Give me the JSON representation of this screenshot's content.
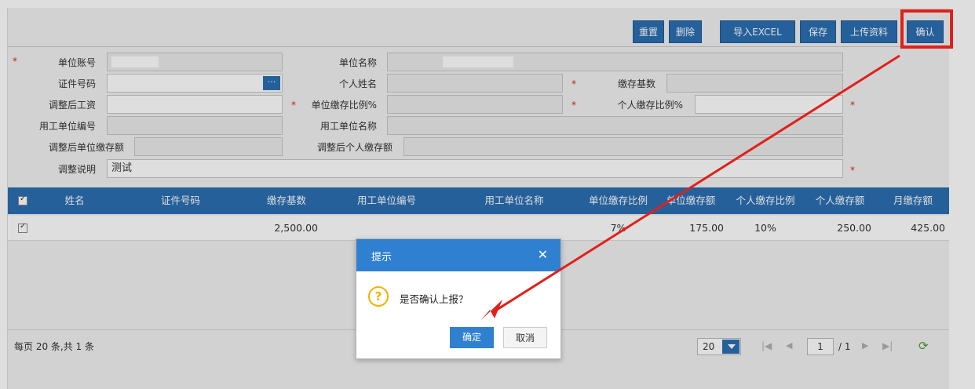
{
  "toolbar": {
    "buttons": [
      {
        "label": "重置"
      },
      {
        "label": "删除"
      },
      {
        "label": "导入EXCEL"
      },
      {
        "label": "保存"
      },
      {
        "label": "上传资料"
      },
      {
        "label": "确认"
      }
    ]
  },
  "form": {
    "required_mark": "*",
    "ellipsis": "···",
    "labels": {
      "unit_account": "单位账号",
      "unit_name": "单位名称",
      "id_number": "证件号码",
      "personal_name": "个人姓名",
      "deposit_base": "缴存基数",
      "adjusted_salary": "调整后工资",
      "unit_ratio": "单位缴存比例%",
      "personal_ratio": "个人缴存比例%",
      "employer_code": "用工单位编号",
      "employer_name": "用工单位名称",
      "adjusted_unit_amount": "调整后单位缴存额",
      "adjusted_personal_amount": "调整后个人缴存额",
      "adjust_note": "调整说明"
    },
    "values": {
      "adjust_note": "测试"
    }
  },
  "grid": {
    "columns": [
      "姓名",
      "证件号码",
      "缴存基数",
      "用工单位编号",
      "用工单位名称",
      "单位缴存比例",
      "单位缴存额",
      "个人缴存比例",
      "个人缴存额",
      "月缴存额"
    ],
    "rows": [
      {
        "base": "2,500.00",
        "unit_ratio": "7%",
        "unit_amount": "175.00",
        "personal_ratio": "10%",
        "personal_amount": "250.00",
        "monthly": "425.00"
      }
    ]
  },
  "pager": {
    "summary": "每页 20 条,共 1 条",
    "page_size": "20",
    "current_page": "1",
    "total_pages": "/ 1"
  },
  "dialog": {
    "title": "提示",
    "message": "是否确认上报？",
    "ok": "确定",
    "cancel": "取消",
    "close": "✕",
    "question_mark": "?"
  },
  "colors": {
    "primary": "#2b6fb3",
    "dialog_header": "#2f80d1",
    "annotation": "#e0201a"
  }
}
